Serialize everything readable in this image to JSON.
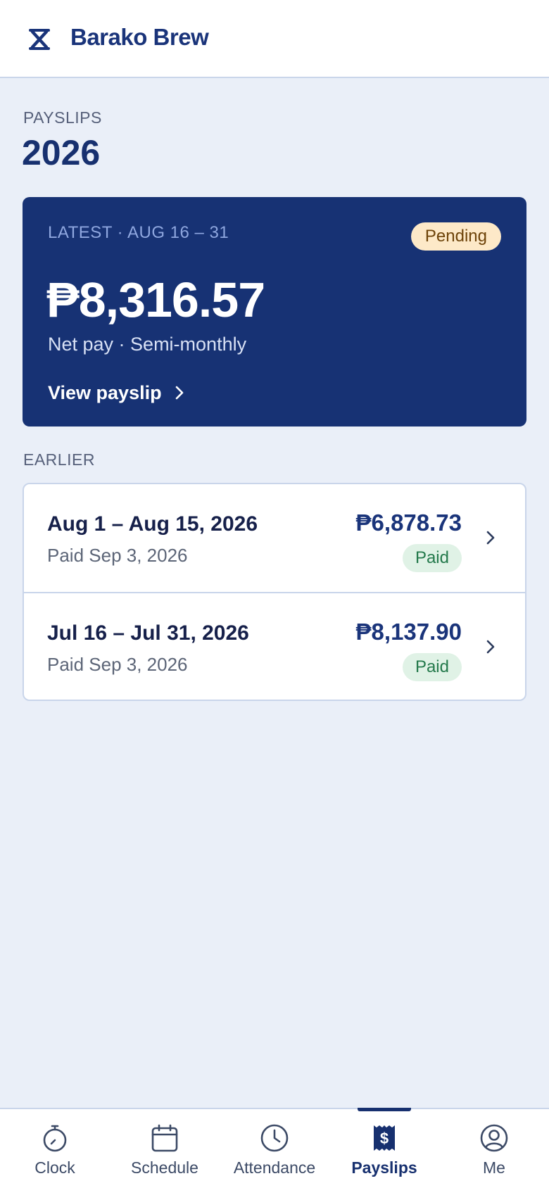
{
  "header": {
    "brand": "Barako Brew",
    "logo_icon": "hourglass-x-logo"
  },
  "page": {
    "eyebrow": "PAYSLIPS",
    "title": "2026"
  },
  "latest": {
    "label": "LATEST · AUG 16 – 31",
    "status": "Pending",
    "amount": "₱8,316.57",
    "subtitle": "Net pay · Semi-monthly",
    "link_label": "View payslip"
  },
  "earlier": {
    "label": "EARLIER",
    "rows": [
      {
        "period": "Aug 1 – Aug 15, 2026",
        "paid_date": "Paid Sep 3, 2026",
        "amount": "₱6,878.73",
        "status": "Paid"
      },
      {
        "period": "Jul 16 – Jul 31, 2026",
        "paid_date": "Paid Sep 3, 2026",
        "amount": "₱8,137.90",
        "status": "Paid"
      }
    ]
  },
  "nav": {
    "items": [
      {
        "label": "Clock",
        "icon": "stopwatch-icon"
      },
      {
        "label": "Schedule",
        "icon": "calendar-icon"
      },
      {
        "label": "Attendance",
        "icon": "clock-icon"
      },
      {
        "label": "Payslips",
        "icon": "receipt-dollar-icon",
        "active": true
      },
      {
        "label": "Me",
        "icon": "user-circle-icon"
      }
    ]
  },
  "colors": {
    "brand_navy": "#173274",
    "background": "#eaeff8",
    "pending_bg": "#fde9c8",
    "pending_text": "#6d4309",
    "paid_bg": "#e0f2e6",
    "paid_text": "#23794b"
  }
}
